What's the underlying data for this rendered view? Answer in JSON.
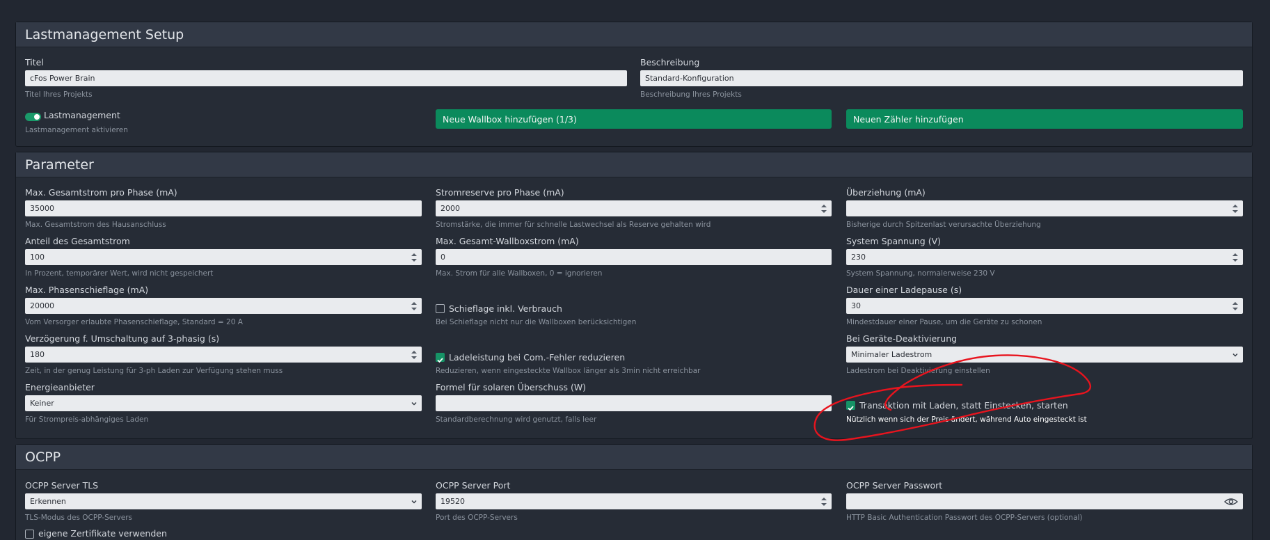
{
  "setup": {
    "title": "Lastmanagement Setup",
    "titel_label": "Titel",
    "titel_value": "cFos Power Brain",
    "titel_hint": "Titel Ihres Projekts",
    "beschreibung_label": "Beschreibung",
    "beschreibung_value": "Standard-Konfiguration",
    "beschreibung_hint": "Beschreibung Ihres Projekts",
    "lastmanagement_label": "Lastmanagement",
    "lastmanagement_hint": "Lastmanagement aktivieren",
    "lastmanagement_enabled": true,
    "add_wallbox_label": "Neue Wallbox hinzufügen (1/3)",
    "add_meter_label": "Neuen Zähler hinzufügen"
  },
  "parameter": {
    "title": "Parameter",
    "max_gesamtstrom_label": "Max. Gesamtstrom pro Phase (mA)",
    "max_gesamtstrom_value": "35000",
    "max_gesamtstrom_hint": "Max. Gesamtstrom des Hausanschluss",
    "stromreserve_label": "Stromreserve pro Phase (mA)",
    "stromreserve_value": "2000",
    "stromreserve_hint": "Stromstärke, die immer für schnelle Lastwechsel als Reserve gehalten wird",
    "ueberziehung_label": "Überziehung (mA)",
    "ueberziehung_value": "",
    "ueberziehung_hint": "Bisherige durch Spitzenlast verursachte Überziehung",
    "anteil_label": "Anteil des Gesamtstrom",
    "anteil_value": "100",
    "anteil_hint": "In Prozent, temporärer Wert, wird nicht gespeichert",
    "max_wallboxstrom_label": "Max. Gesamt-Wallboxstrom (mA)",
    "max_wallboxstrom_value": "0",
    "max_wallboxstrom_hint": "Max. Strom für alle Wallboxen, 0 = ignorieren",
    "system_spannung_label": "System Spannung (V)",
    "system_spannung_value": "230",
    "system_spannung_hint": "System Spannung, normalerweise 230 V",
    "phasenschieflage_label": "Max. Phasenschieflage (mA)",
    "phasenschieflage_value": "20000",
    "phasenschieflage_hint": "Vom Versorger erlaubte Phasenschieflage, Standard = 20 A",
    "schieflage_verbrauch_label": "Schieflage inkl. Verbrauch",
    "schieflage_verbrauch_checked": false,
    "schieflage_verbrauch_hint": "Bei Schieflage nicht nur die Wallboxen berücksichtigen",
    "ladepause_label": "Dauer einer Ladepause (s)",
    "ladepause_value": "30",
    "ladepause_hint": "Mindestdauer einer Pause, um die Geräte zu schonen",
    "verzoegerung_label": "Verzögerung f. Umschaltung auf 3-phasig (s)",
    "verzoegerung_value": "180",
    "verzoegerung_hint": "Zeit, in der genug Leistung für 3-ph Laden zur Verfügung stehen muss",
    "ladeleistung_label": "Ladeleistung bei Com.-Fehler reduzieren",
    "ladeleistung_checked": true,
    "ladeleistung_hint": "Reduzieren, wenn eingesteckte Wallbox länger als 3min nicht erreichbar",
    "deaktivierung_label": "Bei Geräte-Deaktivierung",
    "deaktivierung_value": "Minimaler Ladestrom",
    "deaktivierung_hint": "Ladestrom bei Deaktivierung einstellen",
    "energieanbieter_label": "Energieanbieter",
    "energieanbieter_value": "Keiner",
    "energieanbieter_hint": "Für Strompreis-abhängiges Laden",
    "formel_label": "Formel für solaren Überschuss (W)",
    "formel_value": "",
    "formel_hint": "Standardberechnung wird genutzt, falls leer",
    "transaktion_label": "Transaktion mit Laden, statt Einstecken, starten",
    "transaktion_checked": true,
    "transaktion_hint": "Nützlich wenn sich der Preis ändert, während Auto eingesteckt ist"
  },
  "ocpp": {
    "title": "OCPP",
    "tls_label": "OCPP Server TLS",
    "tls_value": "Erkennen",
    "tls_hint": "TLS-Modus des OCPP-Servers",
    "port_label": "OCPP Server Port",
    "port_value": "19520",
    "port_hint": "Port des OCPP-Servers",
    "passwort_label": "OCPP Server Passwort",
    "passwort_value": "",
    "passwort_hint": "HTTP Basic Authentication Passwort des OCPP-Servers (optional)",
    "zertifikate_label": "eigene Zertifikate verwenden",
    "zertifikate_checked": false
  },
  "icons": {
    "spinner": "number-stepper-icon",
    "dropdown": "chevron-down-icon",
    "password_reveal": "eye-icon",
    "check": "checkmark-icon"
  },
  "colors": {
    "background": "#222731",
    "card": "#262c36",
    "card_header": "#323946",
    "accent_green": "#0b8a5c",
    "annotation_red": "#e8141e"
  }
}
